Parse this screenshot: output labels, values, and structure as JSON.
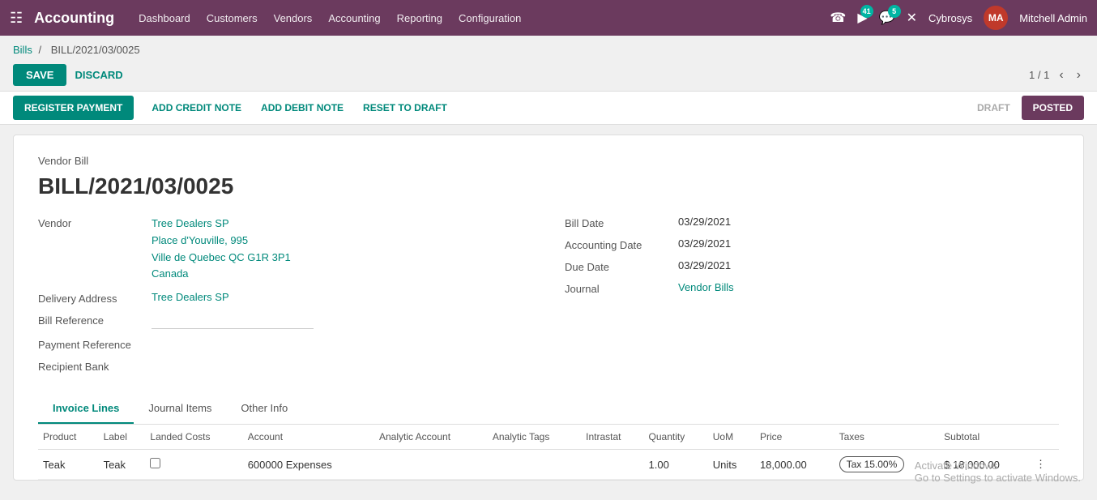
{
  "topnav": {
    "brand": "Accounting",
    "menu_items": [
      "Dashboard",
      "Customers",
      "Vendors",
      "Accounting",
      "Reporting",
      "Configuration"
    ],
    "badge_count_1": "41",
    "badge_count_2": "5",
    "company": "Cybrosys",
    "user": "Mitchell Admin"
  },
  "breadcrumb": {
    "parent": "Bills",
    "separator": "/",
    "current": "BILL/2021/03/0025"
  },
  "toolbar": {
    "save_label": "SAVE",
    "discard_label": "DISCARD",
    "pagination": "1 / 1"
  },
  "button_bar": {
    "register_payment": "REGISTER PAYMENT",
    "add_credit_note": "ADD CREDIT NOTE",
    "add_debit_note": "ADD DEBIT NOTE",
    "reset_to_draft": "RESET TO DRAFT",
    "status_draft": "DRAFT",
    "status_posted": "POSTED"
  },
  "form": {
    "vendor_bill_label": "Vendor Bill",
    "bill_number": "BILL/2021/03/0025",
    "vendor_label": "Vendor",
    "vendor_name": "Tree Dealers SP",
    "vendor_address_line1": "Place d'Youville, 995",
    "vendor_address_line2": "Ville de Quebec QC G1R 3P1",
    "vendor_address_line3": "Canada",
    "delivery_address_label": "Delivery Address",
    "delivery_address_value": "Tree Dealers SP",
    "bill_reference_label": "Bill Reference",
    "payment_reference_label": "Payment Reference",
    "recipient_bank_label": "Recipient Bank",
    "bill_date_label": "Bill Date",
    "bill_date_value": "03/29/2021",
    "accounting_date_label": "Accounting Date",
    "accounting_date_value": "03/29/2021",
    "due_date_label": "Due Date",
    "due_date_value": "03/29/2021",
    "journal_label": "Journal",
    "journal_value": "Vendor Bills"
  },
  "tabs": [
    {
      "id": "invoice-lines",
      "label": "Invoice Lines",
      "active": true
    },
    {
      "id": "journal-items",
      "label": "Journal Items",
      "active": false
    },
    {
      "id": "other-info",
      "label": "Other Info",
      "active": false
    }
  ],
  "table": {
    "columns": [
      "Product",
      "Label",
      "Landed Costs",
      "Account",
      "Analytic Account",
      "Analytic Tags",
      "Intrastat",
      "Quantity",
      "UoM",
      "Price",
      "Taxes",
      "Subtotal"
    ],
    "rows": [
      {
        "product": "Teak",
        "label": "Teak",
        "landed_costs": "",
        "account": "600000 Expenses",
        "analytic_account": "",
        "analytic_tags": "",
        "intrastat": "",
        "quantity": "1.00",
        "uom": "Units",
        "price": "18,000.00",
        "taxes": "Tax 15.00%",
        "subtotal": "$ 18,000.00"
      }
    ]
  },
  "watermark": {
    "line1": "Activate Windows",
    "line2": "Go to Settings to activate Windows."
  }
}
